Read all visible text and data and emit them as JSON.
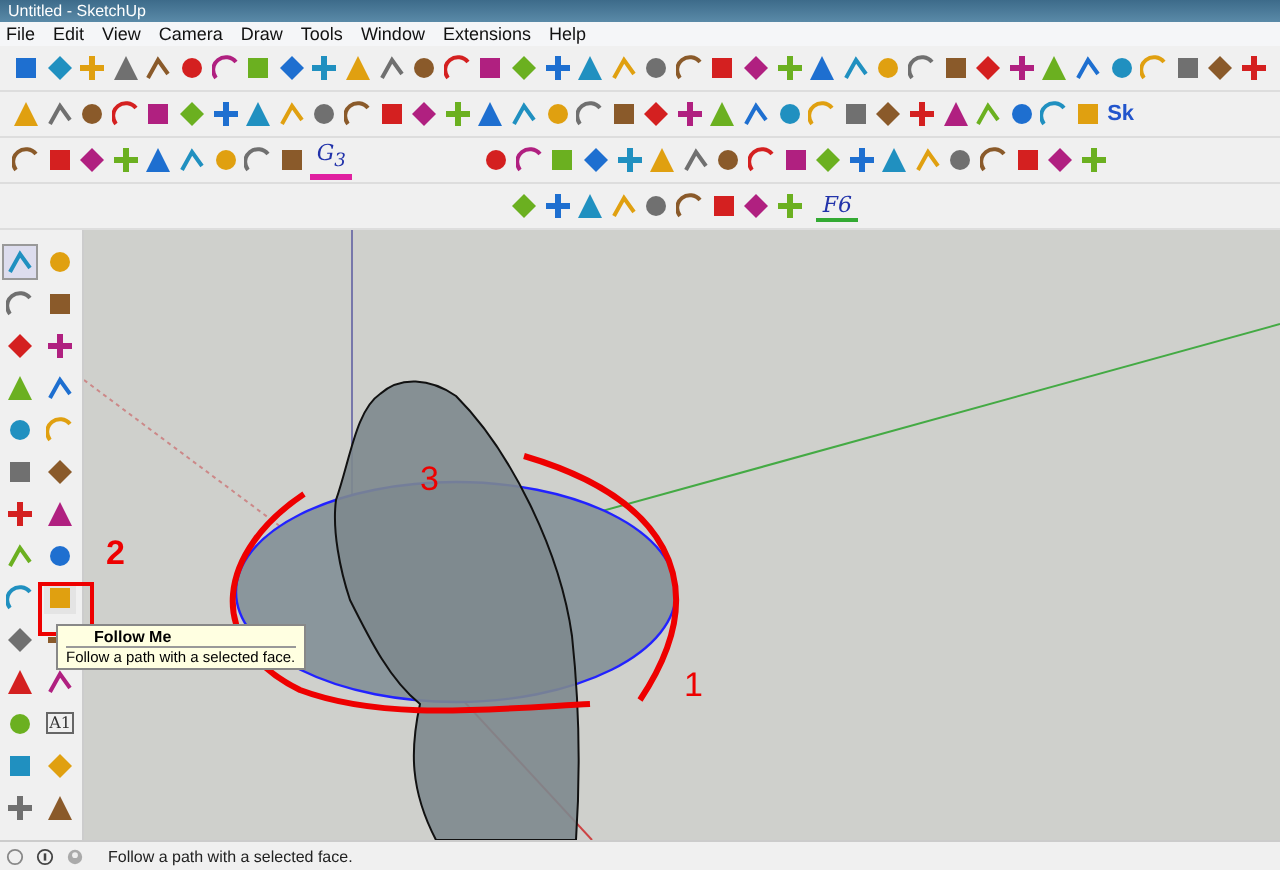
{
  "window": {
    "title": "Untitled - SketchUp"
  },
  "menu": [
    {
      "label": "File"
    },
    {
      "label": "Edit"
    },
    {
      "label": "View"
    },
    {
      "label": "Camera"
    },
    {
      "label": "Draw"
    },
    {
      "label": "Tools"
    },
    {
      "label": "Window"
    },
    {
      "label": "Extensions"
    },
    {
      "label": "Help"
    }
  ],
  "toolbar_glyphs": {
    "logo": "Sk",
    "g3": "G$_{3}$",
    "f6": "F6",
    "label_tool": "A1"
  },
  "annotations": [
    {
      "label": "1"
    },
    {
      "label": "2"
    },
    {
      "label": "3"
    }
  ],
  "tooltip": {
    "title": "Follow Me",
    "description": "Follow a path with a selected face."
  },
  "status_bar": {
    "text": "Follow a path with a selected face."
  }
}
